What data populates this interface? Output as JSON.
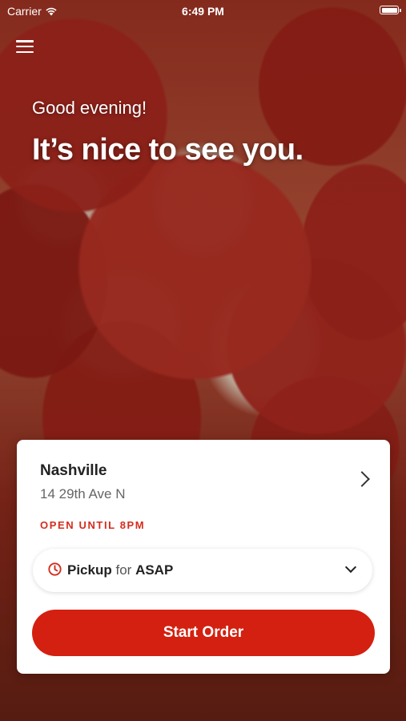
{
  "status_bar": {
    "carrier": "Carrier",
    "time": "6:49 PM"
  },
  "header": {
    "menu_icon": "hamburger-menu-icon"
  },
  "hero": {
    "greeting": "Good evening!",
    "headline": "It’s nice to see you."
  },
  "store": {
    "name": "Nashville",
    "address": "14 29th Ave N",
    "hours": "OPEN UNTIL 8PM"
  },
  "order_mode": {
    "icon": "clock-icon",
    "mode": "Pickup",
    "connector": "for",
    "time": "ASAP"
  },
  "start_order_label": "Start Order",
  "colors": {
    "accent": "#d42010",
    "hours": "#d42d1e"
  }
}
